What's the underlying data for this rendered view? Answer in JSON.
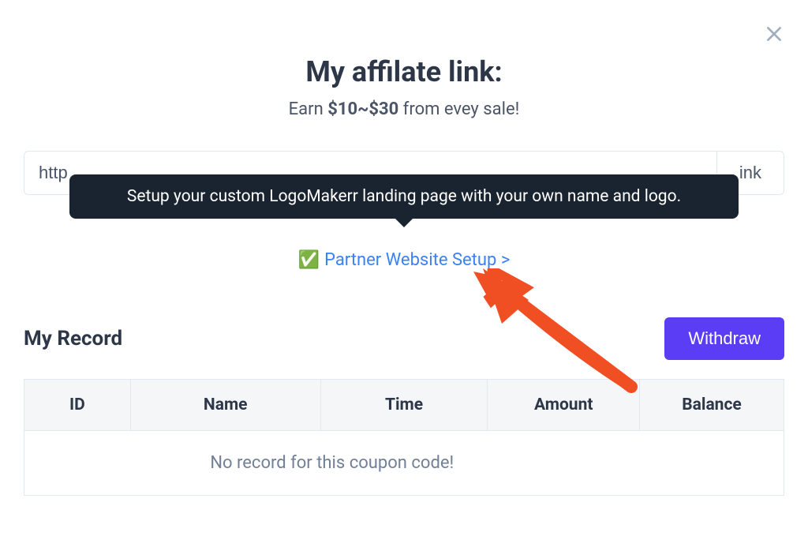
{
  "header": {
    "title": "My affilate link:",
    "subtitle_prefix": "Earn ",
    "subtitle_amount": "$10~$30",
    "subtitle_suffix": " from evey sale!"
  },
  "link": {
    "value": "http",
    "copy_suffix": "ink"
  },
  "tooltip": {
    "text": "Setup your custom LogoMakerr landing page with your own name and logo."
  },
  "partner": {
    "check": "✅",
    "label": "Partner Website Setup >"
  },
  "record": {
    "title": "My Record",
    "withdraw_label": "Withdraw",
    "columns": {
      "id": "ID",
      "name": "Name",
      "time": "Time",
      "amount": "Amount",
      "balance": "Balance"
    },
    "empty_message": "No record for this coupon code!"
  }
}
